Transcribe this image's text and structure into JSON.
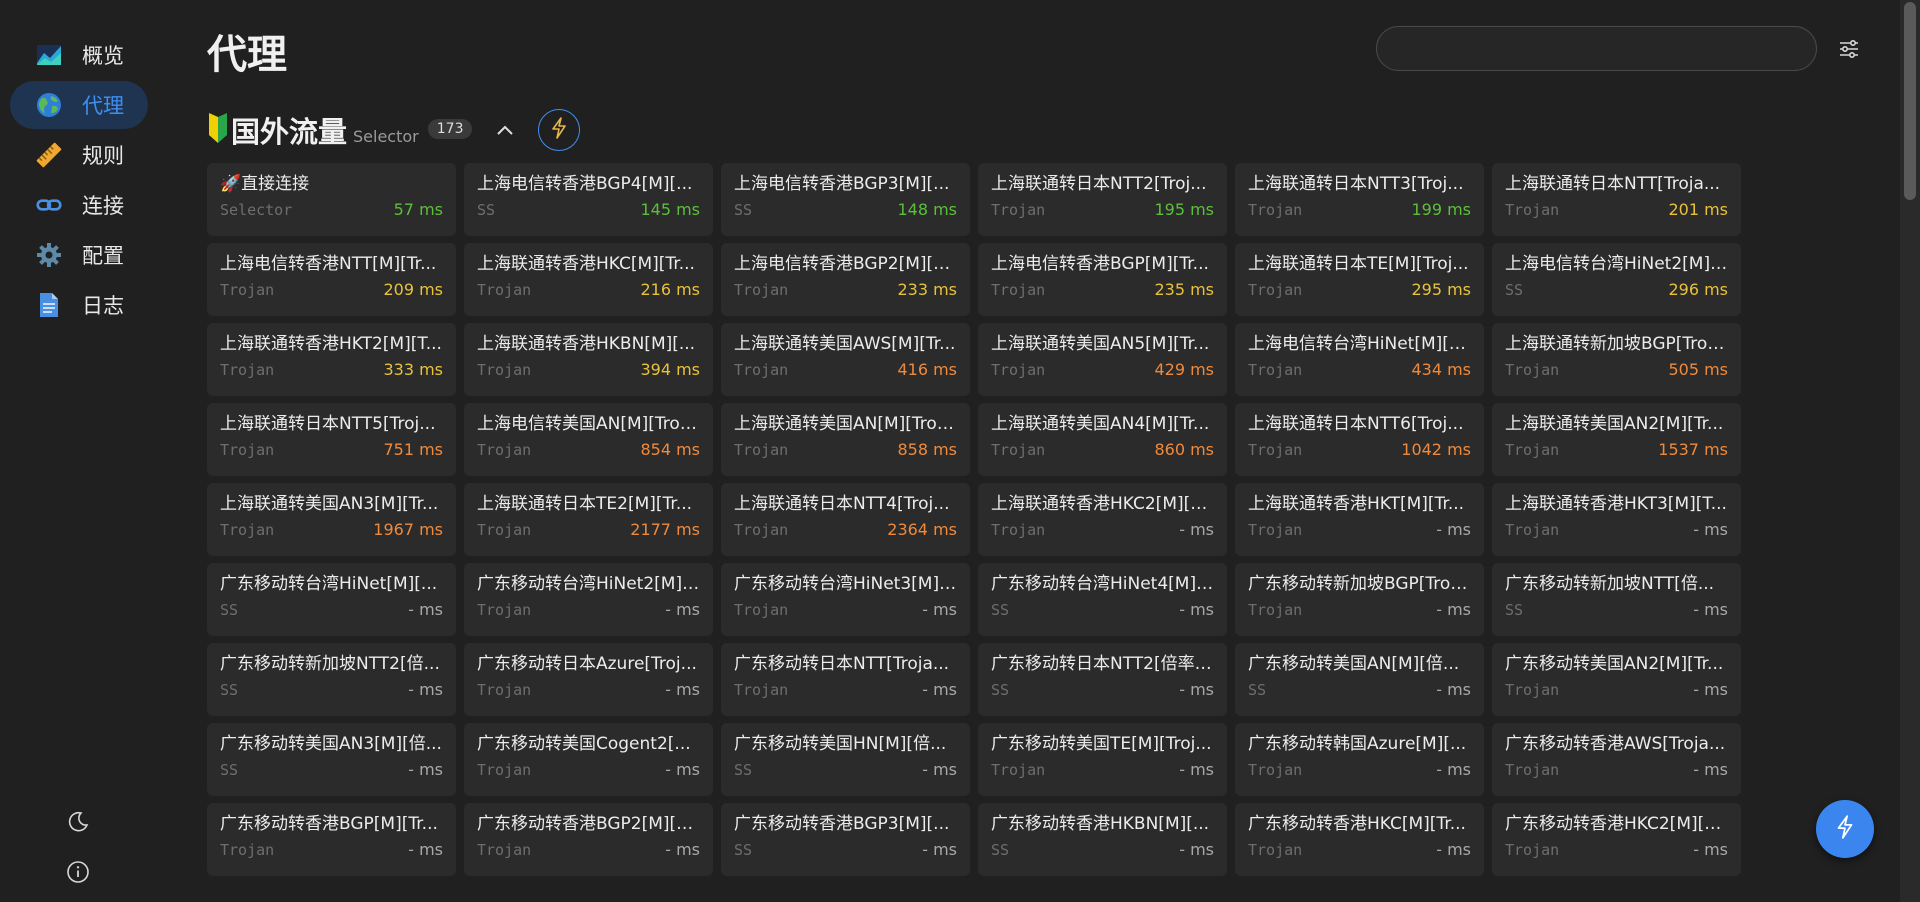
{
  "nav": [
    {
      "label": "概览",
      "icon": "overview-chart-icon",
      "active": false
    },
    {
      "label": "代理",
      "icon": "globe-icon",
      "active": true
    },
    {
      "label": "规则",
      "icon": "ruler-icon",
      "active": false
    },
    {
      "label": "连接",
      "icon": "link-icon",
      "active": false
    },
    {
      "label": "配置",
      "icon": "gear-icon",
      "active": false
    },
    {
      "label": "日志",
      "icon": "document-icon",
      "active": false
    }
  ],
  "page": {
    "title": "代理"
  },
  "search": {
    "value": "",
    "placeholder": ""
  },
  "group": {
    "name": "国外流量",
    "type": "Selector",
    "count": "173"
  },
  "colors": {
    "accent": "#3a85ee",
    "fast": "#5cbf3a",
    "medium": "#e8c23a",
    "slow": "#ef8a3c",
    "none": "#a8a8a8"
  },
  "proxies": [
    {
      "name": "🚀直接连接",
      "type": "Selector",
      "delay": "57 ms",
      "level": "fast"
    },
    {
      "name": "上海电信转香港BGP4[M][...",
      "type": "SS",
      "delay": "145 ms",
      "level": "fast"
    },
    {
      "name": "上海电信转香港BGP3[M][...",
      "type": "SS",
      "delay": "148 ms",
      "level": "fast"
    },
    {
      "name": "上海联通转日本NTT2[Troj...",
      "type": "Trojan",
      "delay": "195 ms",
      "level": "fast"
    },
    {
      "name": "上海联通转日本NTT3[Troj...",
      "type": "Trojan",
      "delay": "199 ms",
      "level": "fast"
    },
    {
      "name": "上海联通转日本NTT[Troja...",
      "type": "Trojan",
      "delay": "201 ms",
      "level": "medium"
    },
    {
      "name": "上海电信转香港NTT[M][Tr...",
      "type": "Trojan",
      "delay": "209 ms",
      "level": "medium"
    },
    {
      "name": "上海联通转香港HKC[M][Tr...",
      "type": "Trojan",
      "delay": "216 ms",
      "level": "medium"
    },
    {
      "name": "上海电信转香港BGP2[M][T...",
      "type": "Trojan",
      "delay": "233 ms",
      "level": "medium"
    },
    {
      "name": "上海电信转香港BGP[M][Tr...",
      "type": "Trojan",
      "delay": "235 ms",
      "level": "medium"
    },
    {
      "name": "上海联通转日本TE[M][Troj...",
      "type": "Trojan",
      "delay": "295 ms",
      "level": "medium"
    },
    {
      "name": "上海电信转台湾HiNet2[M][...",
      "type": "SS",
      "delay": "296 ms",
      "level": "medium"
    },
    {
      "name": "上海联通转香港HKT2[M][T...",
      "type": "Trojan",
      "delay": "333 ms",
      "level": "medium"
    },
    {
      "name": "上海联通转香港HKBN[M][...",
      "type": "Trojan",
      "delay": "394 ms",
      "level": "medium"
    },
    {
      "name": "上海联通转美国AWS[M][Tr...",
      "type": "Trojan",
      "delay": "416 ms",
      "level": "slow"
    },
    {
      "name": "上海联通转美国AN5[M][Tr...",
      "type": "Trojan",
      "delay": "429 ms",
      "level": "slow"
    },
    {
      "name": "上海电信转台湾HiNet[M][T...",
      "type": "Trojan",
      "delay": "434 ms",
      "level": "slow"
    },
    {
      "name": "上海联通转新加坡BGP[Troj...",
      "type": "Trojan",
      "delay": "505 ms",
      "level": "slow"
    },
    {
      "name": "上海联通转日本NTT5[Troj...",
      "type": "Trojan",
      "delay": "751 ms",
      "level": "slow"
    },
    {
      "name": "上海电信转美国AN[M][Troj...",
      "type": "Trojan",
      "delay": "854 ms",
      "level": "slow"
    },
    {
      "name": "上海联通转美国AN[M][Troj...",
      "type": "Trojan",
      "delay": "858 ms",
      "level": "slow"
    },
    {
      "name": "上海联通转美国AN4[M][Tr...",
      "type": "Trojan",
      "delay": "860 ms",
      "level": "slow"
    },
    {
      "name": "上海联通转日本NTT6[Troj...",
      "type": "Trojan",
      "delay": "1042 ms",
      "level": "slow"
    },
    {
      "name": "上海联通转美国AN2[M][Tr...",
      "type": "Trojan",
      "delay": "1537 ms",
      "level": "slow"
    },
    {
      "name": "上海联通转美国AN3[M][Tr...",
      "type": "Trojan",
      "delay": "1967 ms",
      "level": "slow"
    },
    {
      "name": "上海联通转日本TE2[M][Tr...",
      "type": "Trojan",
      "delay": "2177 ms",
      "level": "slow"
    },
    {
      "name": "上海联通转日本NTT4[Troj...",
      "type": "Trojan",
      "delay": "2364 ms",
      "level": "slow"
    },
    {
      "name": "上海联通转香港HKC2[M][T...",
      "type": "Trojan",
      "delay": "- ms",
      "level": "none"
    },
    {
      "name": "上海联通转香港HKT[M][Tr...",
      "type": "Trojan",
      "delay": "- ms",
      "level": "none"
    },
    {
      "name": "上海联通转香港HKT3[M][T...",
      "type": "Trojan",
      "delay": "- ms",
      "level": "none"
    },
    {
      "name": "广东移动转台湾HiNet[M][...",
      "type": "SS",
      "delay": "- ms",
      "level": "none"
    },
    {
      "name": "广东移动转台湾HiNet2[M][...",
      "type": "Trojan",
      "delay": "- ms",
      "level": "none"
    },
    {
      "name": "广东移动转台湾HiNet3[M][...",
      "type": "Trojan",
      "delay": "- ms",
      "level": "none"
    },
    {
      "name": "广东移动转台湾HiNet4[M][...",
      "type": "SS",
      "delay": "- ms",
      "level": "none"
    },
    {
      "name": "广东移动转新加坡BGP[Troj...",
      "type": "Trojan",
      "delay": "- ms",
      "level": "none"
    },
    {
      "name": "广东移动转新加坡NTT[倍...",
      "type": "SS",
      "delay": "- ms",
      "level": "none"
    },
    {
      "name": "广东移动转新加坡NTT2[倍...",
      "type": "SS",
      "delay": "- ms",
      "level": "none"
    },
    {
      "name": "广东移动转日本Azure[Troj...",
      "type": "Trojan",
      "delay": "- ms",
      "level": "none"
    },
    {
      "name": "广东移动转日本NTT[Troja...",
      "type": "Trojan",
      "delay": "- ms",
      "level": "none"
    },
    {
      "name": "广东移动转日本NTT2[倍率:...",
      "type": "SS",
      "delay": "- ms",
      "level": "none"
    },
    {
      "name": "广东移动转美国AN[M][倍...",
      "type": "SS",
      "delay": "- ms",
      "level": "none"
    },
    {
      "name": "广东移动转美国AN2[M][Tr...",
      "type": "Trojan",
      "delay": "- ms",
      "level": "none"
    },
    {
      "name": "广东移动转美国AN3[M][倍...",
      "type": "SS",
      "delay": "- ms",
      "level": "none"
    },
    {
      "name": "广东移动转美国Cogent2[...",
      "type": "Trojan",
      "delay": "- ms",
      "level": "none"
    },
    {
      "name": "广东移动转美国HN[M][倍...",
      "type": "SS",
      "delay": "- ms",
      "level": "none"
    },
    {
      "name": "广东移动转美国TE[M][Troj...",
      "type": "Trojan",
      "delay": "- ms",
      "level": "none"
    },
    {
      "name": "广东移动转韩国Azure[M][...",
      "type": "Trojan",
      "delay": "- ms",
      "level": "none"
    },
    {
      "name": "广东移动转香港AWS[Troja...",
      "type": "Trojan",
      "delay": "- ms",
      "level": "none"
    },
    {
      "name": "广东移动转香港BGP[M][Tr...",
      "type": "Trojan",
      "delay": "- ms",
      "level": "none"
    },
    {
      "name": "广东移动转香港BGP2[M][T...",
      "type": "Trojan",
      "delay": "- ms",
      "level": "none"
    },
    {
      "name": "广东移动转香港BGP3[M][...",
      "type": "SS",
      "delay": "- ms",
      "level": "none"
    },
    {
      "name": "广东移动转香港HKBN[M][...",
      "type": "SS",
      "delay": "- ms",
      "level": "none"
    },
    {
      "name": "广东移动转香港HKC[M][Tr...",
      "type": "Trojan",
      "delay": "- ms",
      "level": "none"
    },
    {
      "name": "广东移动转香港HKC2[M][T...",
      "type": "Trojan",
      "delay": "- ms",
      "level": "none"
    }
  ]
}
